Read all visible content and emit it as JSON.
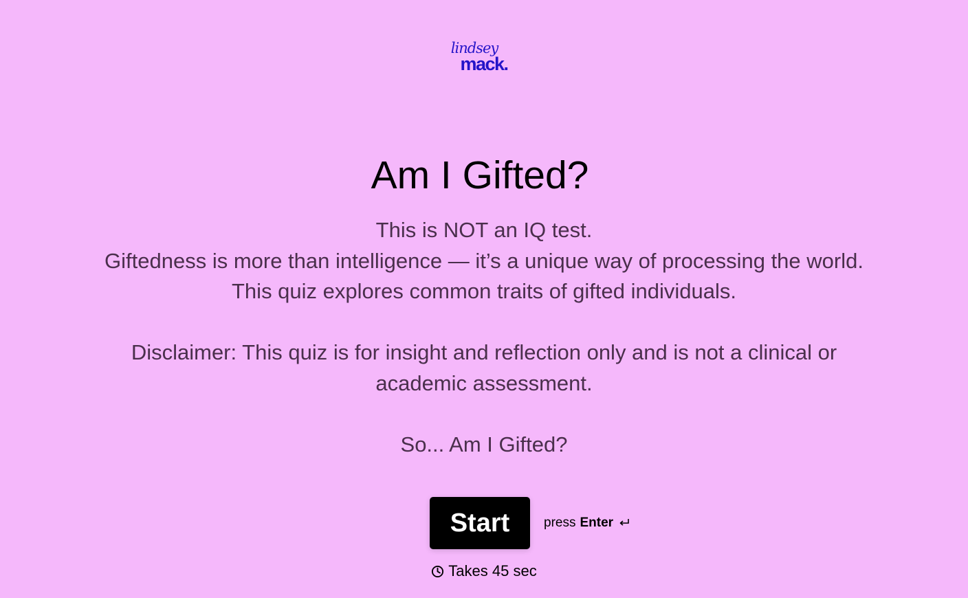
{
  "logo": {
    "script_text": "lindsey",
    "bold_text": "mack.",
    "color": "#2414c8"
  },
  "title": "Am I Gifted?",
  "description": {
    "line1": "This is NOT an IQ test.",
    "line2": "Giftedness is more than intelligence — it’s a unique way of processing the world.",
    "line3": "This quiz explores common traits of gifted individuals.",
    "disclaimer_line1": "Disclaimer: This quiz is for insight and reflection only and is not a clinical or",
    "disclaimer_line2": "academic assessment.",
    "closing": "So... Am I Gifted?"
  },
  "start_button": {
    "label": "Start"
  },
  "hint": {
    "prefix": "press",
    "key": "Enter",
    "icon": "enter-return-icon"
  },
  "duration": {
    "icon": "clock-icon",
    "text": "Takes 45 sec"
  },
  "colors": {
    "background": "#f5b8fb",
    "body_text": "#4a2f4c",
    "button_bg": "#000000",
    "button_text": "#ffffff"
  }
}
